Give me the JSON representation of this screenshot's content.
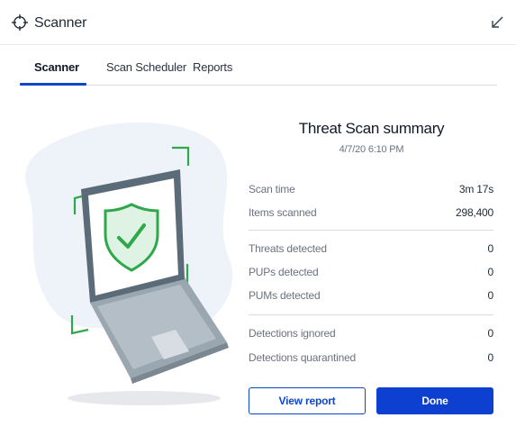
{
  "window": {
    "title": "Scanner",
    "app_icon": "crosshair-icon",
    "minimize_icon": "minimize-arrow-icon"
  },
  "tabs": [
    {
      "label": "Scanner",
      "active": true
    },
    {
      "label": "Scan Scheduler",
      "active": false
    },
    {
      "label": "Reports",
      "active": false
    }
  ],
  "summary": {
    "title": "Threat Scan summary",
    "date": "4/7/20 6:10 PM",
    "rows": [
      {
        "label": "Scan time",
        "value": "3m 17s"
      },
      {
        "label": "Items scanned",
        "value": "298,400"
      },
      {
        "label": "Threats detected",
        "value": "0"
      },
      {
        "label": "PUPs detected",
        "value": "0"
      },
      {
        "label": "PUMs detected",
        "value": "0"
      },
      {
        "label": "Detections ignored",
        "value": "0"
      },
      {
        "label": "Detections quarantined",
        "value": "0"
      }
    ]
  },
  "buttons": {
    "view_report": "View report",
    "done": "Done"
  },
  "illustration": {
    "icon": "laptop-shield-check-icon"
  },
  "colors": {
    "accent": "#0d47c8",
    "primary_button": "#0d3fd0",
    "shield_green": "#2ea84a",
    "bracket_green": "#2ea84a",
    "laptop_grey": "#5c6b78",
    "blob": "#eef3fa"
  }
}
